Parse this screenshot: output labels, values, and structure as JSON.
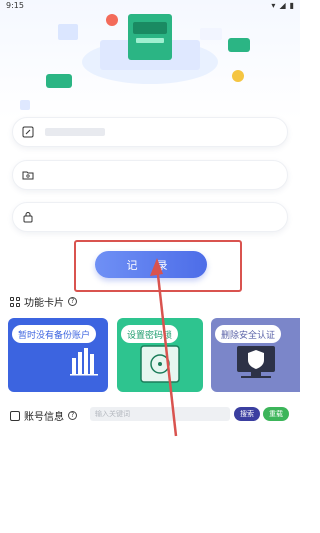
{
  "status_bar": {
    "time": "9:15"
  },
  "form": {
    "password_value": "",
    "file_value": "",
    "lock_value": ""
  },
  "login": {
    "label": "记 录"
  },
  "features": {
    "title": "功能卡片",
    "cards": [
      {
        "label": "暂时没有备份账户",
        "color": "#3c64e0"
      },
      {
        "label": "设置密码锁",
        "color": "#2ec48f"
      },
      {
        "label": "删除安全认证",
        "color": "#7b86c9"
      }
    ]
  },
  "account_info": {
    "title": "账号信息",
    "search_placeholder": "输入关键词",
    "search_label": "搜索",
    "reload_label": "重载"
  },
  "colors": {
    "accent": "#4d6de8",
    "highlight": "#d9534f"
  }
}
